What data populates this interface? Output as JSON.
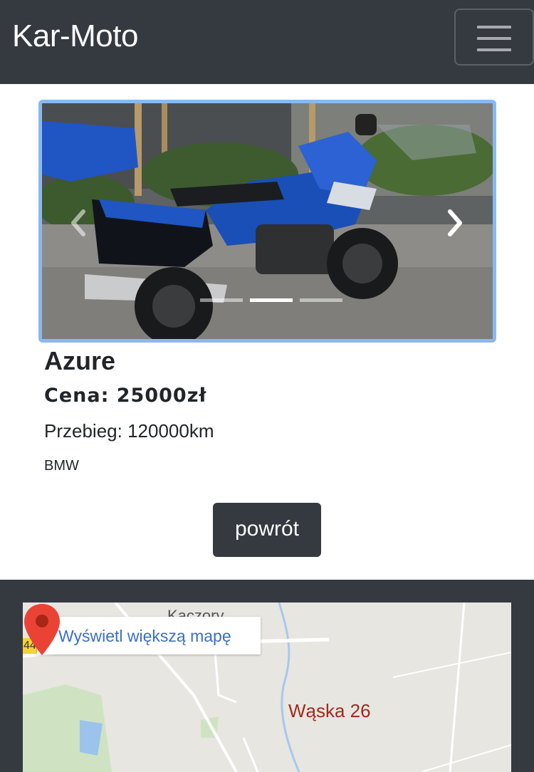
{
  "navbar": {
    "brand": "Kar-Moto",
    "toggle_icon": "hamburger-menu-icon"
  },
  "carousel": {
    "slide_count": 3,
    "active_index": 1,
    "prev_icon": "chevron-left-icon",
    "next_icon": "chevron-right-icon"
  },
  "listing": {
    "model": "Azure",
    "price": "Cena: 25000zł",
    "mileage": "Przebieg: 120000km",
    "brand": "BMW",
    "back_label": "powrót"
  },
  "map": {
    "larger_map_link": "Wyświetl większą mapę",
    "place_name": "Kaczory",
    "road_number": "44",
    "pin_label": "Wąska 26",
    "pin_icon": "map-pin-icon"
  },
  "colors": {
    "navbar": "#343a40",
    "carousel_border": "#8ab8ef",
    "link": "#3a6fc7",
    "pin": "#ea4335"
  }
}
